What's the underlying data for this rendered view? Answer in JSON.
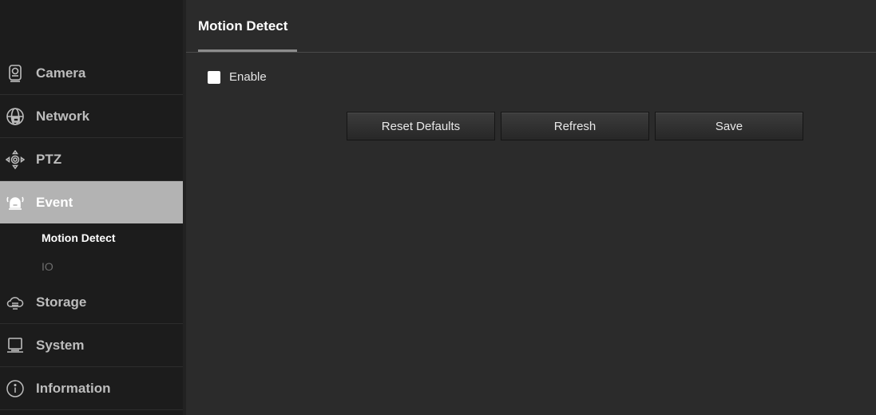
{
  "sidebar": {
    "items": [
      {
        "label": "Camera",
        "icon": "camera-icon"
      },
      {
        "label": "Network",
        "icon": "network-icon"
      },
      {
        "label": "PTZ",
        "icon": "ptz-icon"
      },
      {
        "label": "Event",
        "icon": "alarm-icon",
        "active": true
      },
      {
        "label": "Storage",
        "icon": "cloud-storage-icon"
      },
      {
        "label": "System",
        "icon": "computer-icon"
      },
      {
        "label": "Information",
        "icon": "info-icon"
      }
    ],
    "event_subitems": [
      {
        "label": "Motion Detect",
        "active": true
      },
      {
        "label": "IO",
        "active": false
      }
    ]
  },
  "main": {
    "tab": "Motion Detect",
    "enable_label": "Enable",
    "enable_checked": false,
    "buttons": {
      "reset": "Reset Defaults",
      "refresh": "Refresh",
      "save": "Save"
    }
  },
  "colors": {
    "sidebar_bg": "#1c1c1c",
    "main_bg": "#2b2b2b",
    "active_item_bg": "#b3b3b3"
  }
}
